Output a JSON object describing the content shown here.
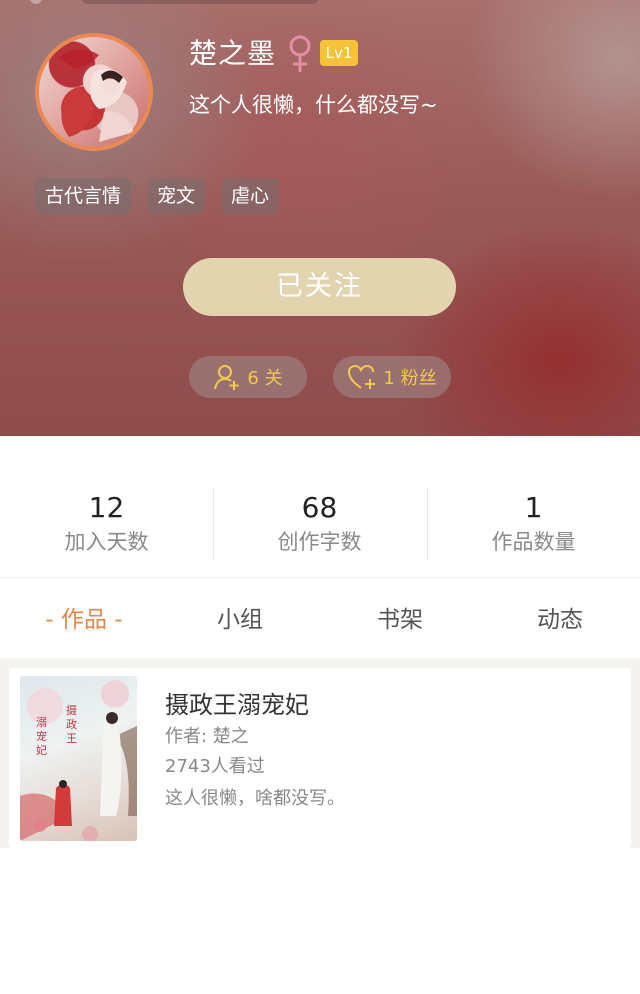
{
  "profile": {
    "username": "楚之墨",
    "level": "Lv1",
    "bio": "这个人很懒，什么都没写~",
    "tags": [
      "古代言情",
      "宠文",
      "虐心"
    ],
    "follow_button": "已关注",
    "following_label": "6 关",
    "fans_label": "1 粉丝"
  },
  "stats": [
    {
      "value": "12",
      "label": "加入天数"
    },
    {
      "value": "68",
      "label": "创作字数"
    },
    {
      "value": "1",
      "label": "作品数量"
    }
  ],
  "tabs": [
    {
      "label": "- 作品 -",
      "active": true
    },
    {
      "label": "小组",
      "active": false
    },
    {
      "label": "书架",
      "active": false
    },
    {
      "label": "动态",
      "active": false
    }
  ],
  "works": [
    {
      "title": "摄政王溺宠妃",
      "author": "作者: 楚之",
      "views": "2743人看过",
      "desc": "这人很懒，啥都没写。",
      "cover_text_left": "溺宠妃",
      "cover_text_right": "摄政王"
    }
  ],
  "colors": {
    "accent": "#e5864c",
    "gold": "#f2c94c",
    "badge": "#f5c23a",
    "follow_button": "#e3d4b0",
    "gender": "#e38ea6"
  },
  "icons": {
    "gender": "female-symbol-icon",
    "following": "add-user-icon",
    "fans": "heart-add-icon"
  }
}
